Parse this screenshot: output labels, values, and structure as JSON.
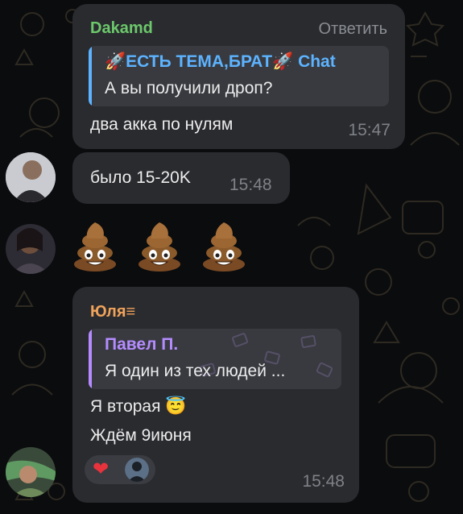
{
  "messages": [
    {
      "sender": "Dakamd",
      "reply_action": "Ответить",
      "quote": {
        "name": "🚀ЕСТЬ ТЕМА,БРАТ🚀 Chat",
        "text": "А вы получили дроп?"
      },
      "text": "два акка по нулям",
      "time": "15:47"
    },
    {
      "text": "было 15-20K",
      "time": "15:48"
    },
    {
      "emojis": [
        "poop",
        "poop",
        "poop"
      ]
    },
    {
      "sender": "Юля≡",
      "quote": {
        "name": "Павел П.",
        "text": "Я один из тех людей ..."
      },
      "lines": [
        "Я вторая 😇",
        "Ждём 9июня"
      ],
      "reactions": [
        "heart",
        "avatar"
      ],
      "time": "15:48"
    }
  ],
  "colors": {
    "bubble": "#2a2b2f",
    "sender_green": "#6cc86b",
    "sender_orange": "#f0a35b",
    "quote_blue": "#5db3ff",
    "quote_purple": "#b58cff",
    "background": "#0b0c0e"
  }
}
